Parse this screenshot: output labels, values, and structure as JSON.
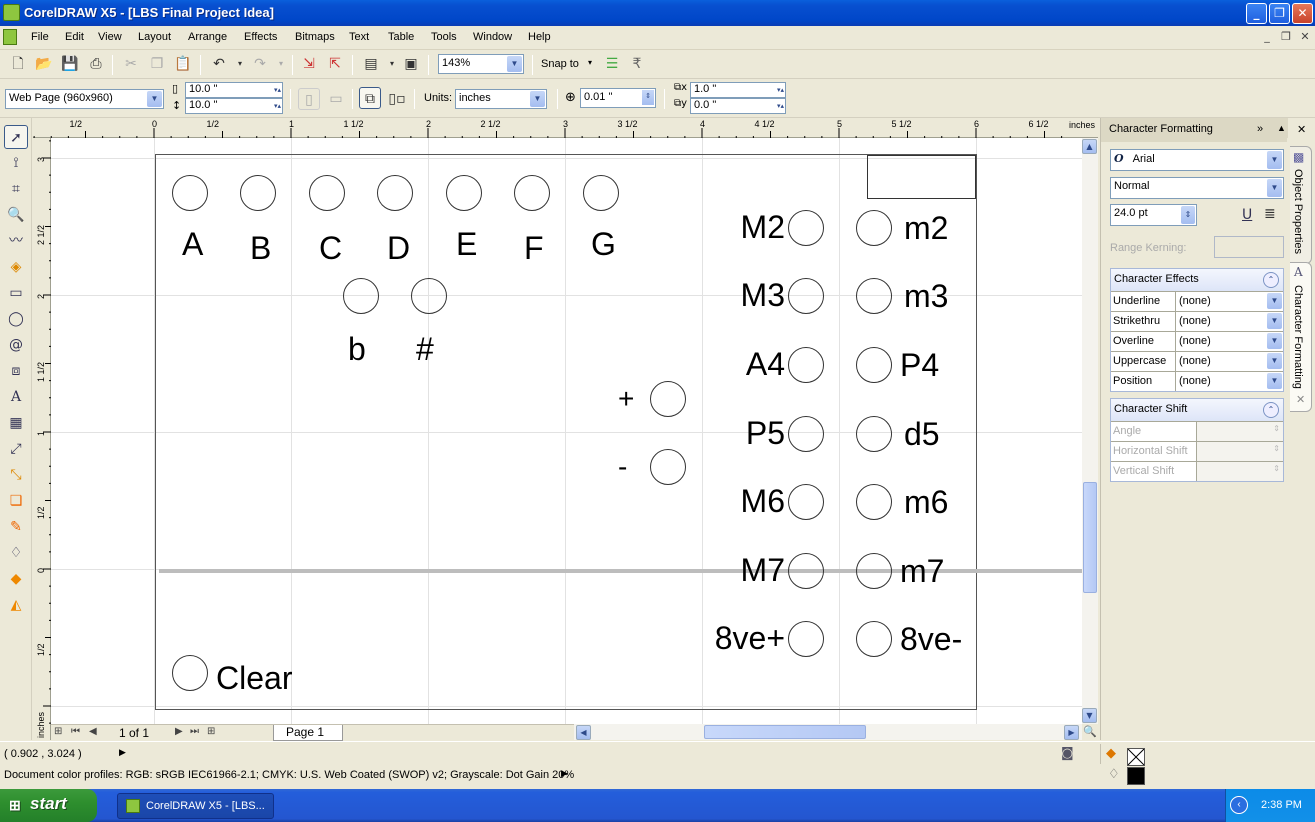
{
  "window": {
    "title": "CorelDRAW X5 - [LBS Final Project Idea]",
    "controls": {
      "minimize": "_",
      "restore": "❐",
      "close": "✕"
    },
    "doc_controls": {
      "minimize": "_",
      "restore": "❐",
      "close": "✕"
    }
  },
  "menu": [
    "File",
    "Edit",
    "View",
    "Layout",
    "Arrange",
    "Effects",
    "Bitmaps",
    "Text",
    "Table",
    "Tools",
    "Window",
    "Help"
  ],
  "standard_toolbar": {
    "zoom_level": "143%",
    "snap_to": "Snap to"
  },
  "property_bar": {
    "page_preset": "Web Page (960x960)",
    "width": "10.0 \"",
    "height": "10.0 \"",
    "units_label": "Units:",
    "units": "inches",
    "nudge": "0.01 \"",
    "dup_x": "1.0 \"",
    "dup_y": "0.0 \""
  },
  "rulers": {
    "unit": "inches",
    "h_labels": [
      "1/2",
      "0",
      "1/2",
      "1",
      "1 1/2",
      "2",
      "2 1/2",
      "3",
      "3 1/2",
      "4",
      "4 1/2",
      "5",
      "5 1/2",
      "6",
      "6 1/2"
    ],
    "v_labels": [
      "3",
      "2 1/2",
      "2",
      "1 1/2",
      "1",
      "1/2",
      "0",
      "1/2"
    ]
  },
  "canvas": {
    "notes": [
      {
        "label": "A"
      },
      {
        "label": "B"
      },
      {
        "label": "C"
      },
      {
        "label": "D"
      },
      {
        "label": "E"
      },
      {
        "label": "F"
      },
      {
        "label": "G"
      }
    ],
    "accidentals": [
      {
        "label": "b"
      },
      {
        "label": "#"
      }
    ],
    "octave": [
      {
        "label": "+"
      },
      {
        "label": "-"
      }
    ],
    "intervals_left": [
      {
        "label": "M2"
      },
      {
        "label": "M3"
      },
      {
        "label": "A4"
      },
      {
        "label": "P5"
      },
      {
        "label": "M6"
      },
      {
        "label": "M7"
      },
      {
        "label": "8ve+"
      }
    ],
    "intervals_right": [
      {
        "label": "m2"
      },
      {
        "label": "m3"
      },
      {
        "label": "P4"
      },
      {
        "label": "d5"
      },
      {
        "label": "m6"
      },
      {
        "label": "m7"
      },
      {
        "label": "8ve-"
      }
    ],
    "clear_label": "Clear"
  },
  "page_nav": {
    "counter": "1 of 1",
    "page_tab": "Page 1"
  },
  "docker": {
    "title": "Character Formatting",
    "font": "Arial",
    "style": "Normal",
    "size": "24.0 pt",
    "range_kerning_label": "Range Kerning:",
    "effects_title": "Character Effects",
    "effects": [
      {
        "label": "Underline",
        "value": "(none)"
      },
      {
        "label": "Strikethru",
        "value": "(none)"
      },
      {
        "label": "Overline",
        "value": "(none)"
      },
      {
        "label": "Uppercase",
        "value": "(none)"
      },
      {
        "label": "Position",
        "value": "(none)"
      }
    ],
    "shift_title": "Character Shift",
    "shift": [
      {
        "label": "Angle"
      },
      {
        "label": "Horizontal Shift"
      },
      {
        "label": "Vertical Shift"
      }
    ],
    "tabs": [
      "Object Properties",
      "Character Formatting"
    ]
  },
  "status": {
    "coordinates": "( 0.902 , 3.024 )",
    "color_profiles": "Document color profiles: RGB: sRGB IEC61966-2.1; CMYK: U.S. Web Coated (SWOP) v2; Grayscale: Dot Gain 20%"
  },
  "taskbar": {
    "start": "start",
    "task": "CorelDRAW X5 - [LBS...",
    "clock": "2:38 PM"
  }
}
